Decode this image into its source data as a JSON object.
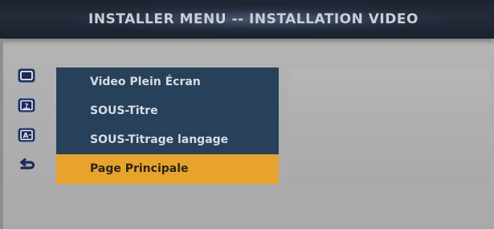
{
  "header": {
    "title": "INSTALLER MENU -- INSTALLATION VIDEO"
  },
  "menu": {
    "items": [
      {
        "label": "Video Plein Écran",
        "icon": "screen-icon"
      },
      {
        "label": "SOUS-Titre",
        "icon": "subtitle-icon"
      },
      {
        "label": "SOUS-Titrage langage",
        "icon": "subtitle-language-icon"
      }
    ],
    "selected": {
      "label": "Page Principale",
      "icon": "return-icon"
    }
  },
  "colors": {
    "menu_bg": "#27415a",
    "selected_bg": "#e7a32c",
    "title_bar_bg": "#1d2330",
    "screen_bg": "#b0b0b0"
  }
}
